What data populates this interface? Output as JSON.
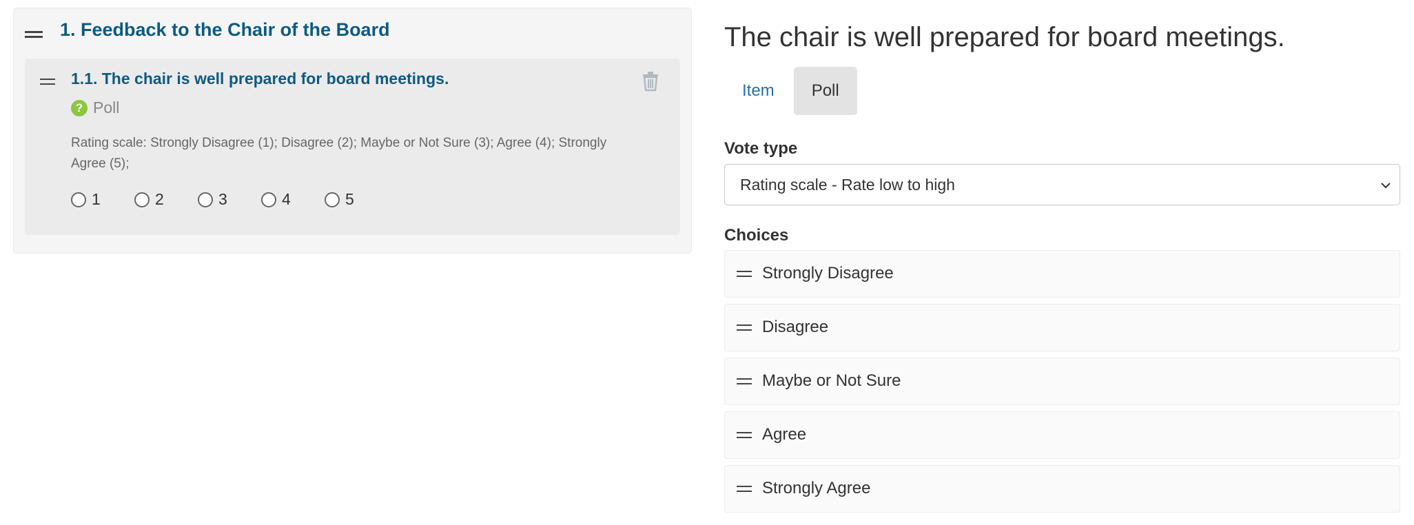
{
  "agenda": {
    "section_title": "1. Feedback to the Chair of the Board",
    "item": {
      "title": "1.1. The chair is well prepared for board meetings.",
      "badge_icon": "?",
      "badge_label": "Poll",
      "rating_description": "Rating scale: Strongly Disagree (1); Disagree (2); Maybe or Not Sure (3); Agree (4); Strongly Agree (5);",
      "options": [
        "1",
        "2",
        "3",
        "4",
        "5"
      ]
    }
  },
  "editor": {
    "heading": "The chair is well prepared for board meetings.",
    "tabs": [
      {
        "label": "Item",
        "active": false
      },
      {
        "label": "Poll",
        "active": true
      }
    ],
    "vote_type_label": "Vote type",
    "vote_type_value": "Rating scale - Rate low to high",
    "choices_label": "Choices",
    "choices": [
      "Strongly Disagree",
      "Disagree",
      "Maybe or Not Sure",
      "Agree",
      "Strongly Agree"
    ]
  },
  "colors": {
    "title_blue": "#0e5a82",
    "link_blue": "#2a6fa8",
    "poll_green": "#8cc63f"
  }
}
